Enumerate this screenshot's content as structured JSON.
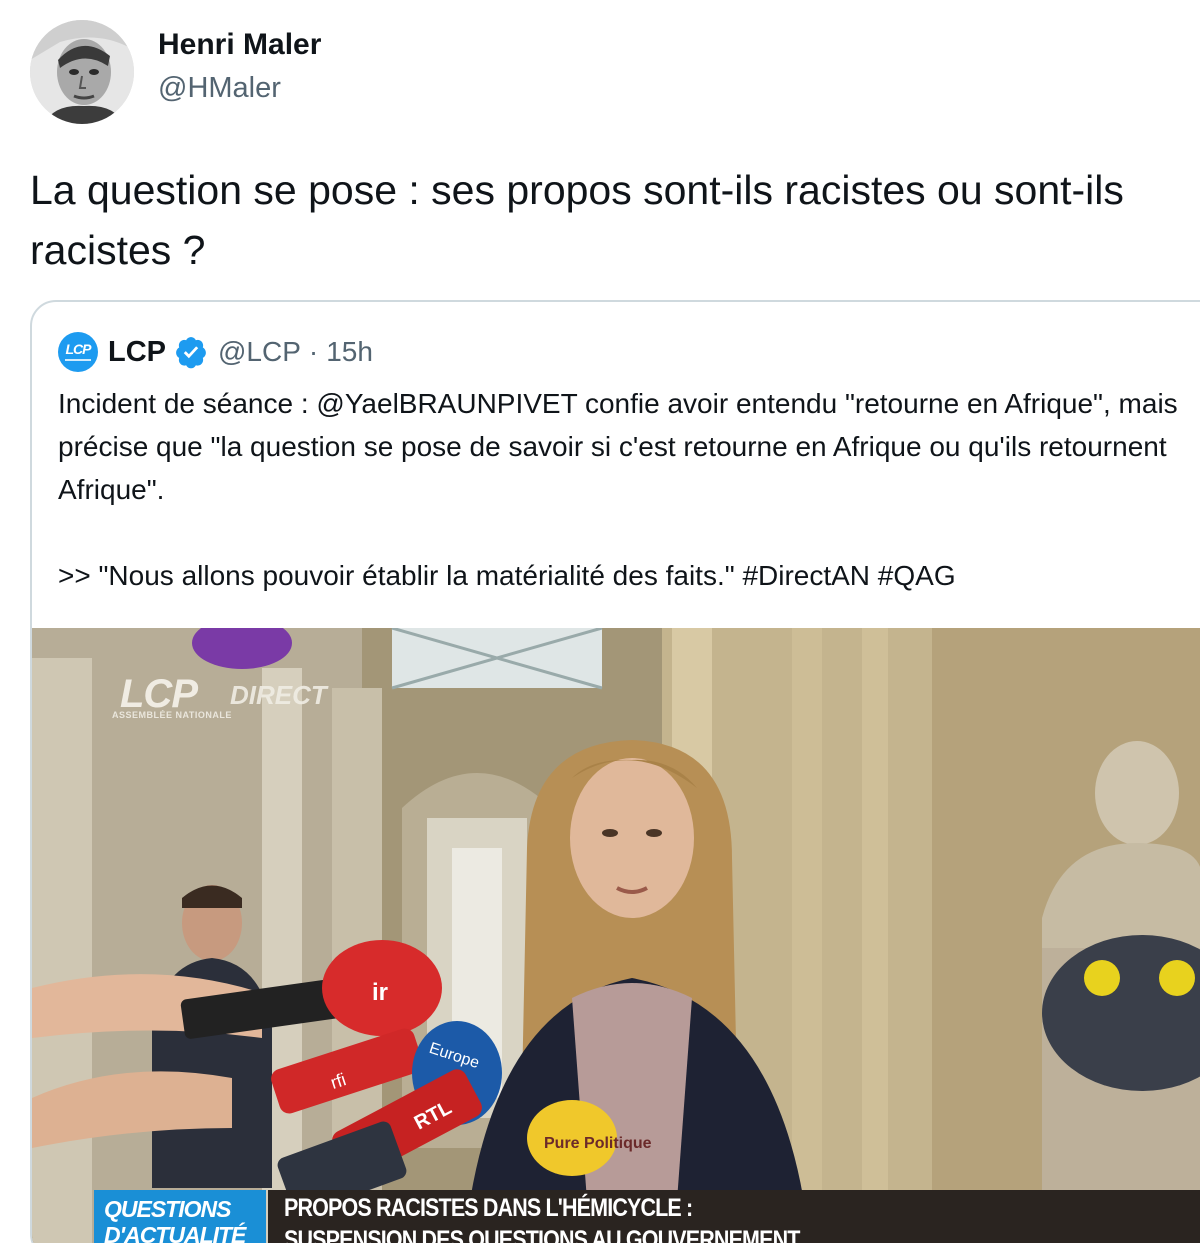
{
  "tweet": {
    "author_name": "Henri Maler",
    "author_handle": "@HMaler",
    "text": "La question se pose : ses propos sont-ils racistes ou sont-ils racistes ?"
  },
  "quoted": {
    "logo_text": "LCP",
    "name": "LCP",
    "handle": "@LCP",
    "separator": "·",
    "time": "15h",
    "text": "Incident de séance : @YaelBRAUNPIVET confie avoir entendu \"retourne en Afrique\", mais précise que \"la question se pose de savoir si c'est retourne en Afrique ou qu'ils retournent Afrique\".\n\n>> \"Nous allons pouvoir établir la matérialité des faits.\" #DirectAN #QAG",
    "media": {
      "channel_bug": "LCP",
      "channel_sub": "ASSEMBLÉE NATIONALE",
      "live_label": "DIRECT",
      "section_line1": "QUESTIONS",
      "section_line2": "D'ACTUALITÉ",
      "headline_line1": "PROPOS RACISTES DANS L'HÉMICYCLE :",
      "headline_line2": "SUSPENSION DES QUESTIONS AU GOUVERNEMENT",
      "mic_labels": [
        "ir",
        "Europe",
        "RTL",
        "rfi",
        "Pure Politique"
      ]
    }
  },
  "colors": {
    "verified": "#1d9bf0",
    "secondary_text": "#536471",
    "border": "#cfd9de",
    "lcp_blue": "#1a8fd6"
  }
}
